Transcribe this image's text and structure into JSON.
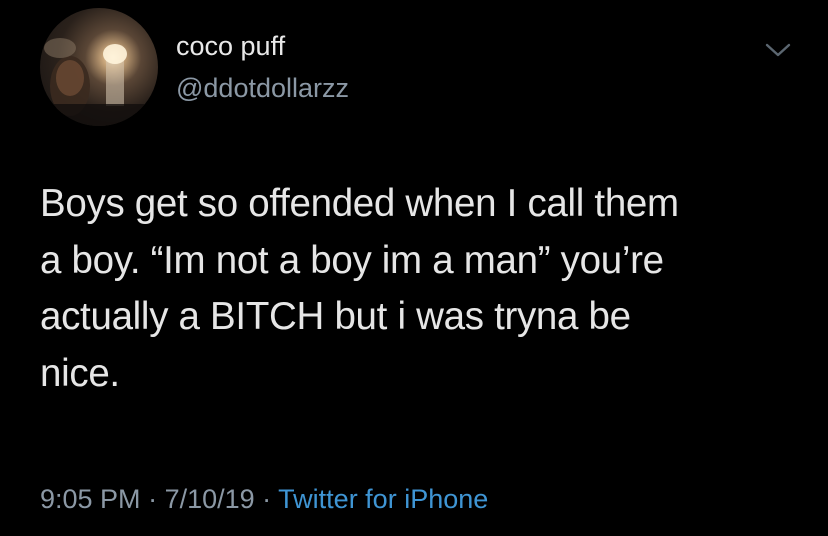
{
  "tweet": {
    "display_name": "coco puff",
    "handle": "@ddotdollarzz",
    "text": "Boys get so offended when I call them\na boy. “Im not a boy im a man” you’re\nactually a BITCH but i was tryna be\nnice.",
    "time": "9:05 PM",
    "date": "7/10/19",
    "separator": " · ",
    "source": "Twitter for iPhone"
  },
  "icons": {
    "avatar": "user-avatar",
    "menu": "chevron-down-icon"
  },
  "colors": {
    "background": "#000000",
    "text": "#e6e6e6",
    "secondary": "#8b98a5",
    "link": "#3f95d4"
  }
}
